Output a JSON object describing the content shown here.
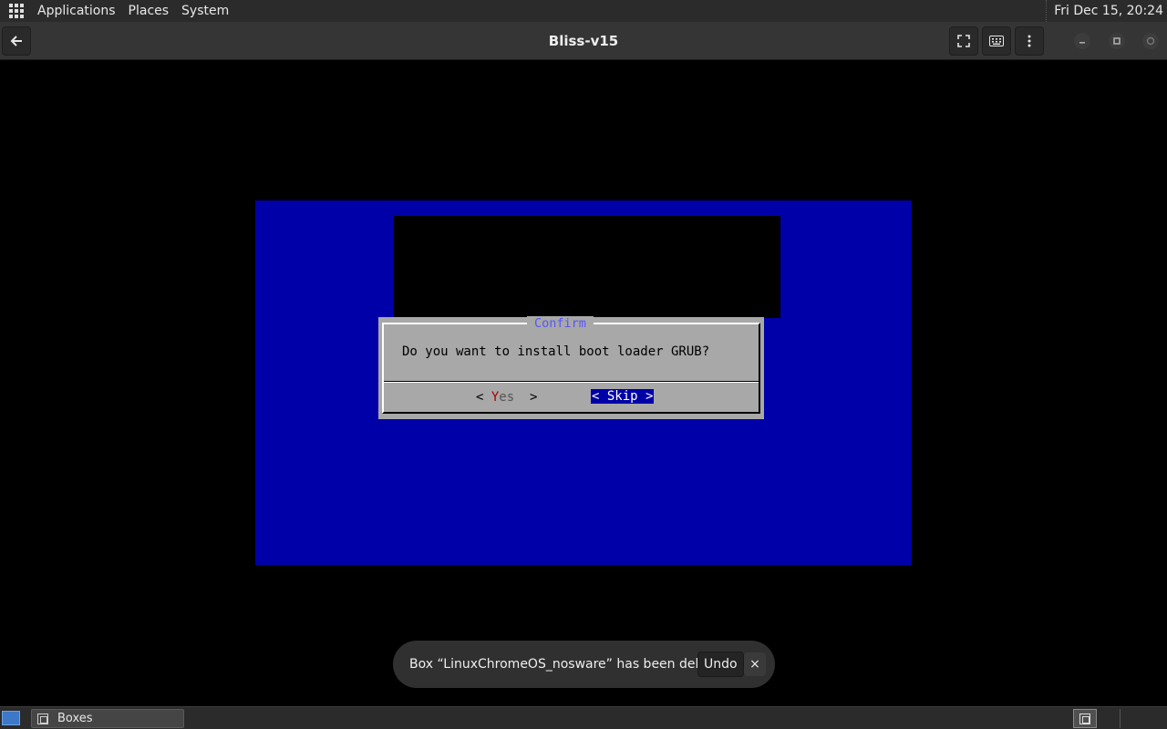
{
  "top_panel": {
    "menus": [
      "Applications",
      "Places",
      "System"
    ],
    "clock": "Fri Dec 15, 20:24"
  },
  "headerbar": {
    "title": "Bliss-v15",
    "icons": {
      "back": "back-arrow-icon",
      "fullscreen": "fullscreen-icon",
      "keyboard": "keyboard-icon",
      "menu": "kebab-menu-icon"
    }
  },
  "vm": {
    "screen_color": "#0000a8",
    "dialog": {
      "title": "Confirm",
      "message": "Do you want to install boot loader GRUB?",
      "yes_open": "< ",
      "yes_hotkey": "Y",
      "yes_rest": "es",
      "yes_close": "  >",
      "skip_label": "< Skip >"
    }
  },
  "toast": {
    "message": "Box “LinuxChromeOS_nosware” has been deleted",
    "undo_label": "Undo",
    "close_label": "×"
  },
  "bottom_panel": {
    "task_label": "Boxes"
  }
}
